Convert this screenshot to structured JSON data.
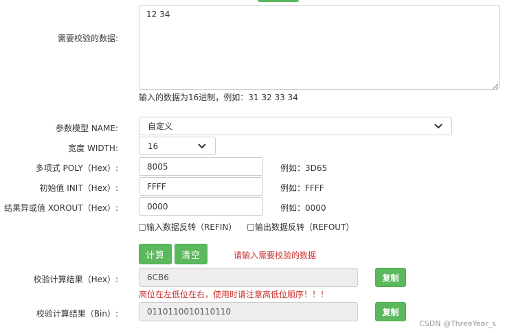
{
  "data_field": {
    "label": "需要校验的数据:",
    "value": "12 34"
  },
  "data_hint": "输入的数据为16进制，例如：31 32 33 34",
  "model": {
    "label": "参数模型 NAME:",
    "selected": "自定义"
  },
  "width": {
    "label": "宽度 WIDTH:",
    "selected": "16"
  },
  "poly": {
    "label": "多项式 POLY（Hex）:",
    "value": "8005",
    "example": "例如：3D65"
  },
  "init": {
    "label": "初始值 INIT（Hex）:",
    "value": "FFFF",
    "example": "例如：FFFF"
  },
  "xorout": {
    "label": "结果异或值 XOROUT（Hex）:",
    "value": "0000",
    "example": "例如：0000"
  },
  "refin": {
    "label": "输入数据反转（REFIN）",
    "checked": false
  },
  "refout": {
    "label": "输出数据反转（REFOUT）",
    "checked": false
  },
  "buttons": {
    "calculate": "计算",
    "clear": "清空"
  },
  "status_message": "请输入需要校验的数据",
  "result_hex": {
    "label": "校验计算结果（Hex）:",
    "value": "6CB6",
    "copy": "复制"
  },
  "bit_order_warning": "高位在左低位在右，使用时请注意高低位顺序！！！",
  "result_bin": {
    "label": "校验计算结果（Bin）:",
    "value": "0110110010110110",
    "copy": "复制"
  },
  "watermark": "CSDN @ThreeYear_s",
  "colors": {
    "button_green": "#5cb85c",
    "warning_red": "#c9302c",
    "readonly_bg": "#eeeeee"
  }
}
